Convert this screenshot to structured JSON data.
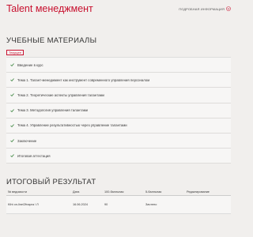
{
  "header": {
    "course_title": "Talent менеджмент",
    "more_info_label": "ПОДРОБНАЯ ИНФОРМАЦИЯ"
  },
  "materials": {
    "heading": "УЧЕБНЫЕ МАТЕРИАЛЫ",
    "current_label": "Текущее",
    "items": [
      {
        "label": "Введение в курс"
      },
      {
        "label": "Тема 1. Талант-менеджмент как инструмент современного управления персоналом"
      },
      {
        "label": "Тема 2. Теоретические аспекты управления талантами"
      },
      {
        "label": "Тема 3. Методология управления талантами"
      },
      {
        "label": "Тема 4. Управление результативностью через управление талантами"
      },
      {
        "label": "Заключение"
      },
      {
        "label": "Итоговая аттестация"
      }
    ]
  },
  "result": {
    "heading": "ИТОГОВЫЙ РЕЗУЛЬТАТ",
    "columns": [
      "№ ведомости",
      "Дата",
      "100-балльная",
      "5-балльная",
      "Редактирование"
    ],
    "rows": [
      [
        "Kiht on-line/2fnapra / Л",
        "16.06.2024",
        "90",
        "Зачтено",
        ""
      ]
    ]
  },
  "colors": {
    "accent": "#c8102e",
    "check": "#2e7d32",
    "background": "#f1efed"
  }
}
